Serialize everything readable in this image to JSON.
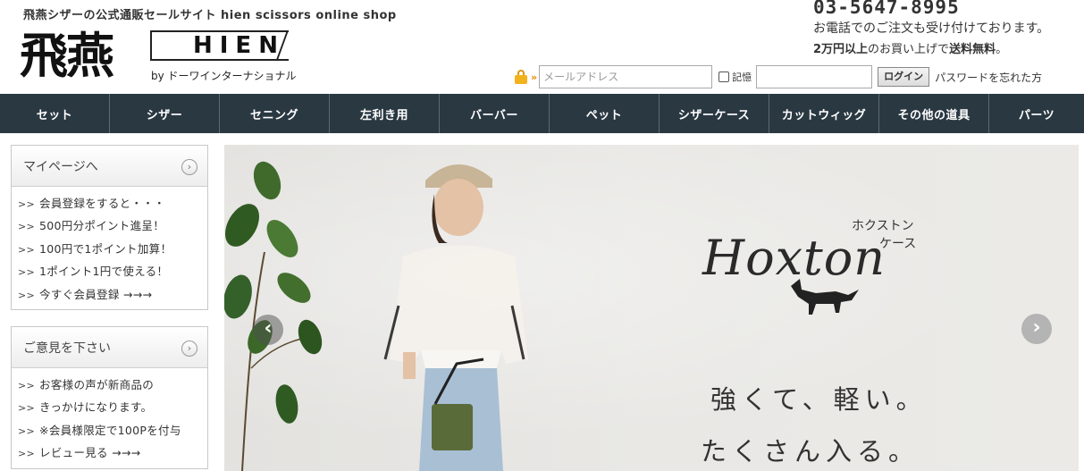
{
  "header": {
    "tagline": "飛燕シザーの公式通販セールサイト hien scissors online shop",
    "logo_kanji": "飛燕",
    "logo_text": "HIEN",
    "logo_by": "by ドーワインターナショナル",
    "phone": "03-5647-8995",
    "phone_note": "お電話でのご注文も受け付けております。",
    "shipping_prefix": "2万円以上",
    "shipping_middle": "のお買い上げで",
    "shipping_free": "送料無料",
    "shipping_suffix": "。"
  },
  "login": {
    "email_placeholder": "メールアドレス",
    "remember_label": "記憶",
    "login_button": "ログイン",
    "forgot_link": "パスワードを忘れた方"
  },
  "nav": {
    "items": [
      {
        "label": "セット"
      },
      {
        "label": "シザー"
      },
      {
        "label": "セニング"
      },
      {
        "label": "左利き用"
      },
      {
        "label": "バーバー"
      },
      {
        "label": "ペット"
      },
      {
        "label": "シザーケース"
      },
      {
        "label": "カットウィッグ"
      },
      {
        "label": "その他の道具"
      },
      {
        "label": "パーツ"
      }
    ]
  },
  "sidebar": {
    "mypage": {
      "title": "マイページへ",
      "items": [
        "会員登録をすると・・・",
        "500円分ポイント進呈！",
        "100円で1ポイント加算！",
        "1ポイント1円で使える！",
        "今すぐ会員登録 →→→"
      ]
    },
    "feedback": {
      "title": "ご意見を下さい",
      "items": [
        "お客様の声が新商品の",
        "きっかけになります。",
        "※会員様限定で100Pを付与",
        "レビュー見る →→→"
      ]
    },
    "list_mark": ">>"
  },
  "banner": {
    "brand_script": "Hoxton",
    "brand_kana_1": "ホクストン",
    "brand_kana_2": "ケース",
    "copy_1": "強くて、軽い。",
    "copy_2": "たくさん入る。",
    "prev_glyph": "‹",
    "next_glyph": "›"
  },
  "colors": {
    "nav_bg": "#2a3842",
    "accent_orange": "#e58a00",
    "lock_gold": "#f2b21b"
  }
}
